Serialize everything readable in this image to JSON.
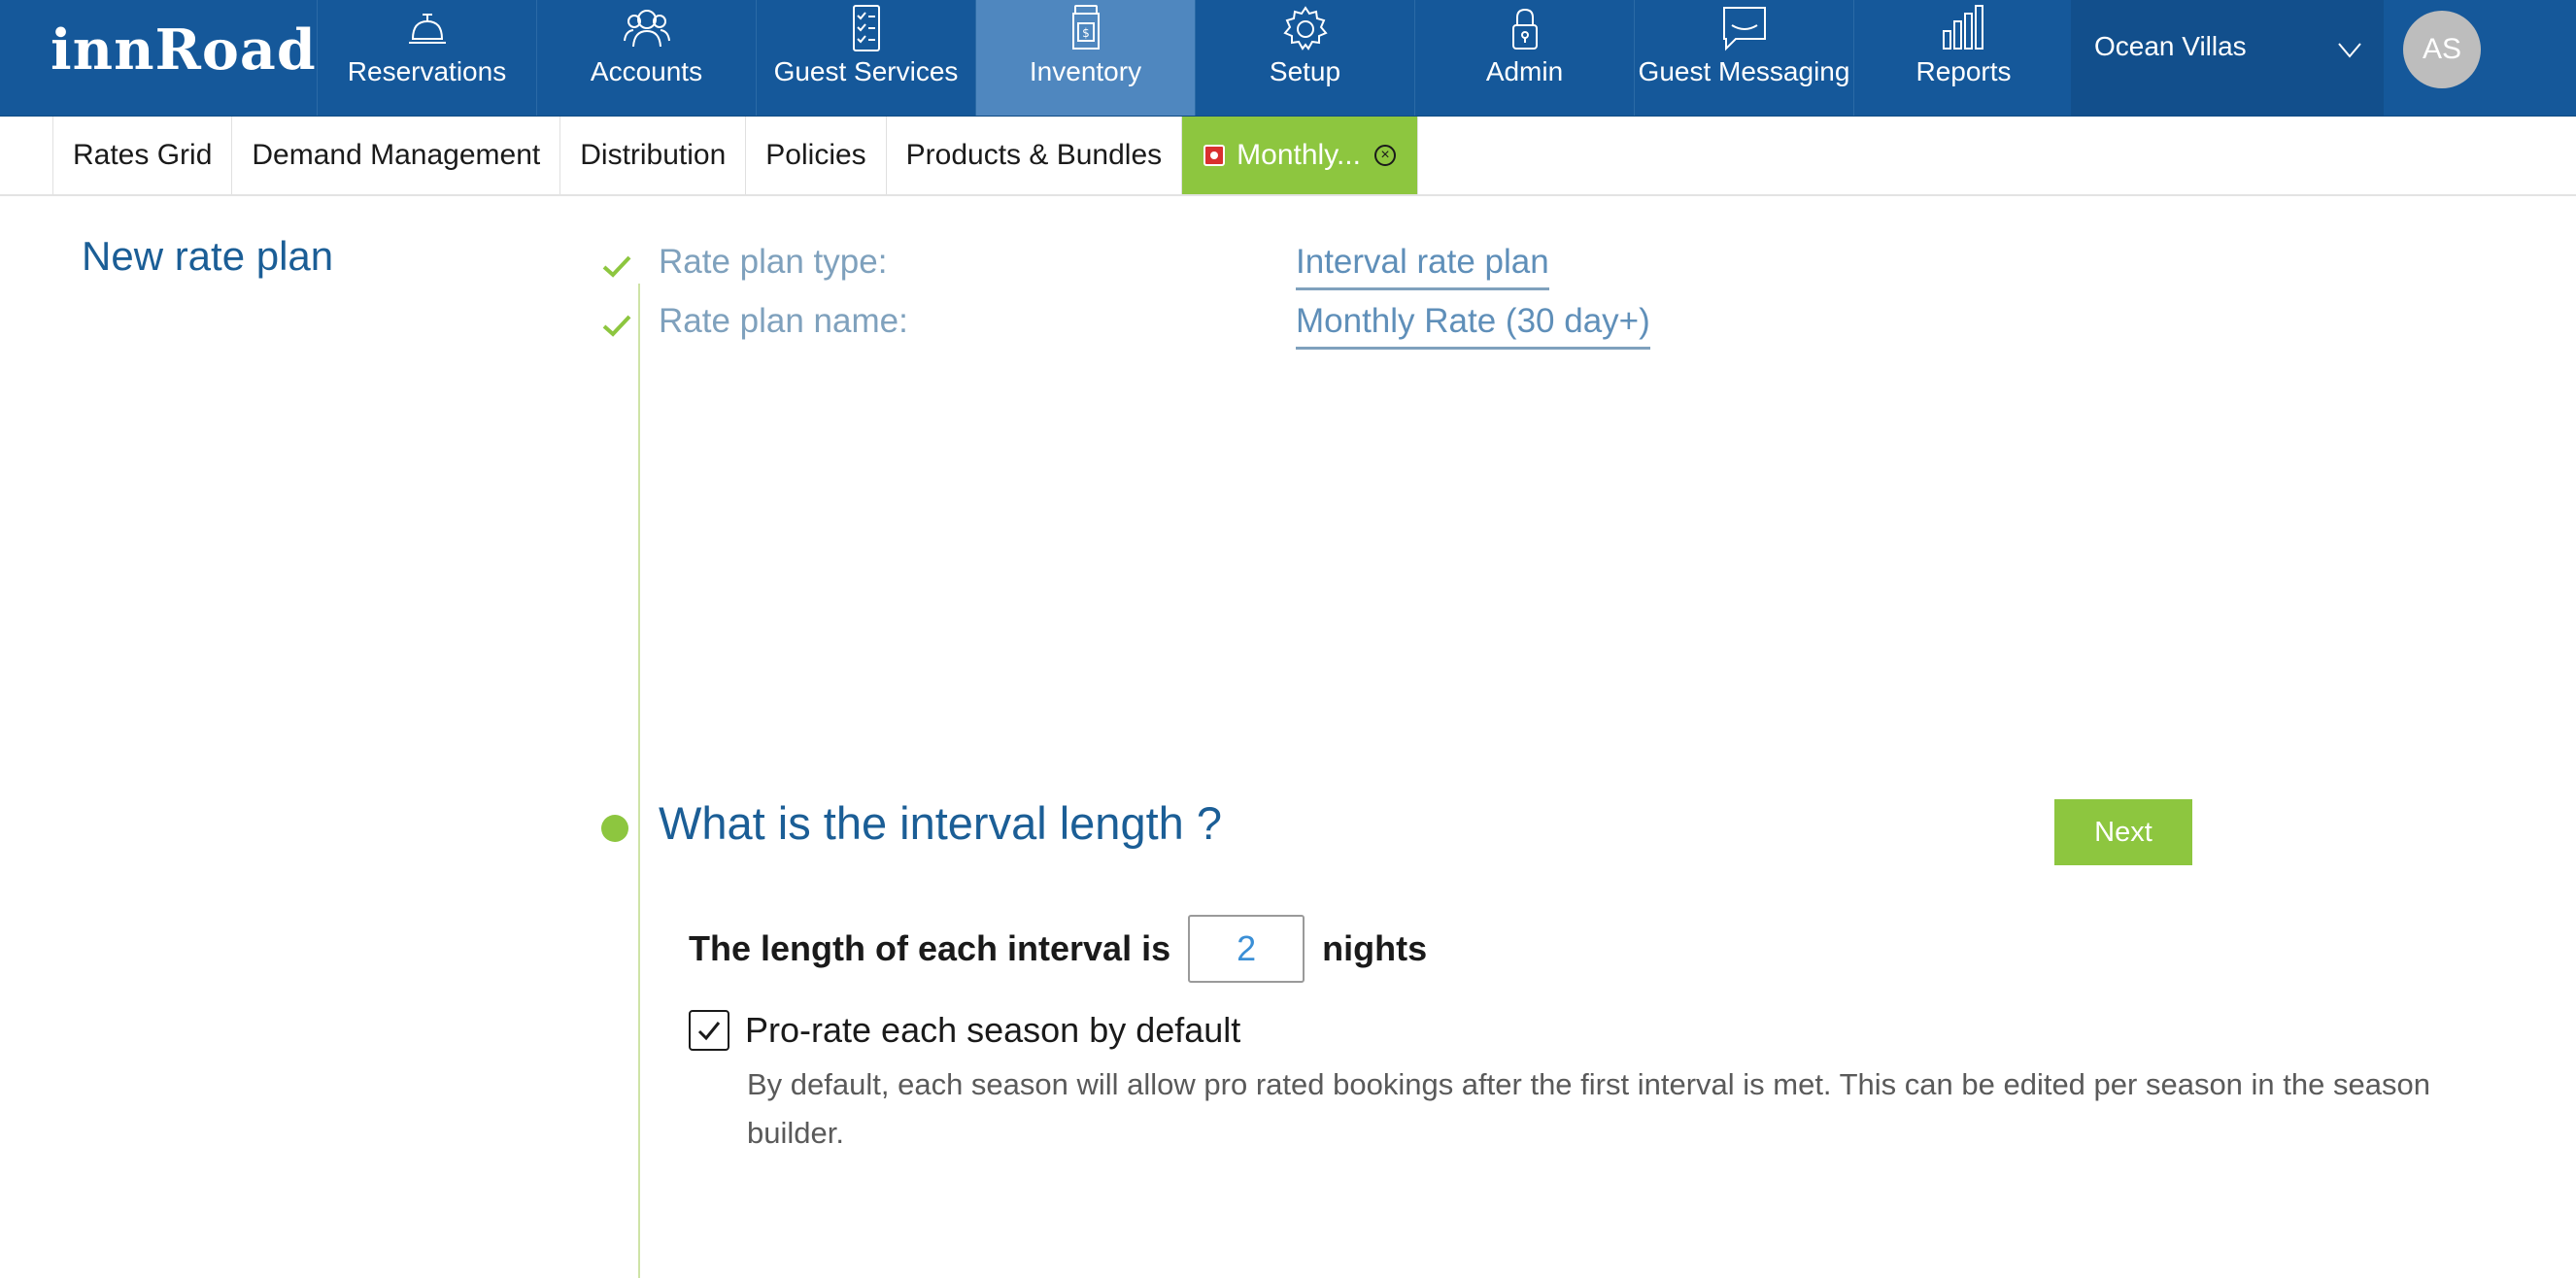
{
  "brand": {
    "logo_text": "innRoad"
  },
  "topnav": {
    "items": [
      {
        "label": "Reservations",
        "icon": "bell-icon"
      },
      {
        "label": "Accounts",
        "icon": "people-icon"
      },
      {
        "label": "Guest Services",
        "icon": "checklist-icon"
      },
      {
        "label": "Inventory",
        "icon": "inventory-jar-icon",
        "active": true
      },
      {
        "label": "Setup",
        "icon": "gear-icon"
      },
      {
        "label": "Admin",
        "icon": "lock-icon"
      },
      {
        "label": "Guest Messaging",
        "icon": "chat-bubble-icon"
      },
      {
        "label": "Reports",
        "icon": "bar-chart-icon"
      }
    ],
    "property_name": "Ocean Villas",
    "user_initials": "AS"
  },
  "subnav": {
    "tabs": [
      {
        "label": "Rates Grid"
      },
      {
        "label": "Demand Management"
      },
      {
        "label": "Distribution"
      },
      {
        "label": "Policies"
      },
      {
        "label": "Products & Bundles"
      },
      {
        "label": "Monthly...",
        "active": true
      }
    ]
  },
  "main": {
    "title": "New rate plan",
    "summary": [
      {
        "label": "Rate plan type:",
        "value": "Interval rate plan"
      },
      {
        "label": "Rate plan name:",
        "value": "Monthly Rate (30 day+)"
      }
    ],
    "step": {
      "title": "What is the interval length ?",
      "next_label": "Next",
      "interval_prefix": "The length of each interval is",
      "interval_value": "2",
      "interval_suffix": "nights",
      "prorate_checked": true,
      "prorate_label": "Pro-rate each season by default",
      "prorate_help": "By default, each season will allow pro rated bookings after the first interval is met. This can be edited per season in the season builder."
    }
  },
  "colors": {
    "nav_bg": "#15589a",
    "nav_active": "#4f87bf",
    "accent_green": "#8dc63f",
    "title_blue": "#1b5e96"
  }
}
